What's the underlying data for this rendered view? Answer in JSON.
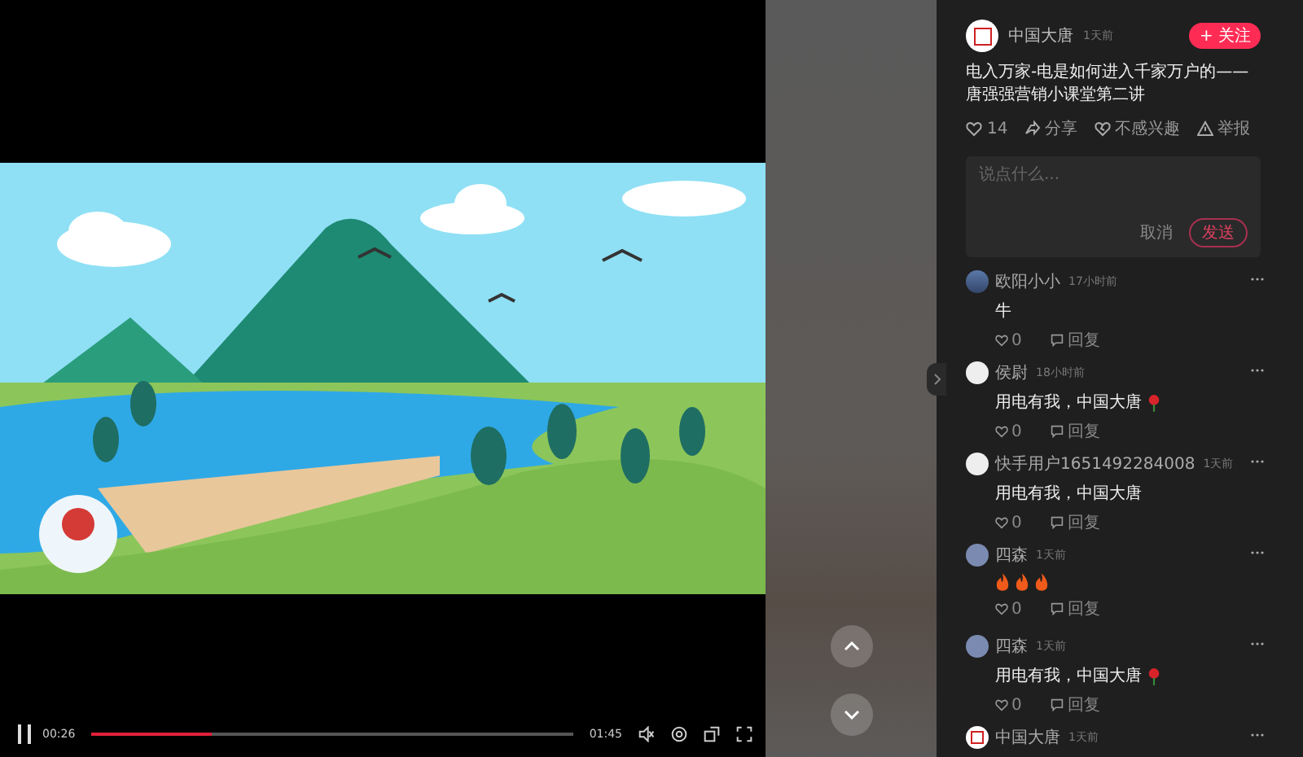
{
  "video": {
    "playing": true,
    "current_time": "00:26",
    "duration": "01:45",
    "level": 0.25
  },
  "post": {
    "author": "中国大唐",
    "time": "1天前",
    "follow_label": "+ 关注",
    "title": "电入万家-电是如何进入千家万户的——唐强强营销小课堂第二讲",
    "actions": [
      {
        "kind": "like",
        "label": "14"
      },
      {
        "kind": "share",
        "label": "分享"
      },
      {
        "kind": "dislike",
        "label": "不感兴趣"
      },
      {
        "kind": "report",
        "label": "举报"
      }
    ]
  },
  "comment_box": {
    "placeholder": "说点什么...",
    "cancel": "取消",
    "submit": "发送"
  },
  "comments": [
    {
      "avatar": {
        "kind": "photo"
      },
      "name": "欧阳小小",
      "time": "17小时前",
      "text": "牛",
      "likes": "0",
      "reply": "回复"
    },
    {
      "avatar": {
        "kind": "blank"
      },
      "name": "侯尉",
      "time": "18小时前",
      "text": "用电有我，中国大唐",
      "icons": [
        {
          "kind": "rose"
        }
      ],
      "likes": "0",
      "reply": "回复"
    },
    {
      "avatar": {
        "kind": "blank"
      },
      "name": "快手用户1651492284008",
      "time": "1天前",
      "text": "用电有我，中国大唐",
      "likes": "0",
      "reply": "回复"
    },
    {
      "avatar": {
        "kind": "cartoon"
      },
      "name": "四森",
      "time": "1天前",
      "icons": [
        {
          "kind": "flame"
        },
        {
          "kind": "flame"
        },
        {
          "kind": "flame"
        }
      ],
      "likes": "0",
      "reply": "回复"
    },
    {
      "avatar": {
        "kind": "cartoon"
      },
      "name": "四森",
      "time": "1天前",
      "text": "用电有我，中国大唐",
      "icons": [
        {
          "kind": "rose"
        }
      ],
      "likes": "0",
      "reply": "回复"
    },
    {
      "avatar": {
        "kind": "logo"
      },
      "name": "中国大唐",
      "time": "1天前"
    }
  ]
}
